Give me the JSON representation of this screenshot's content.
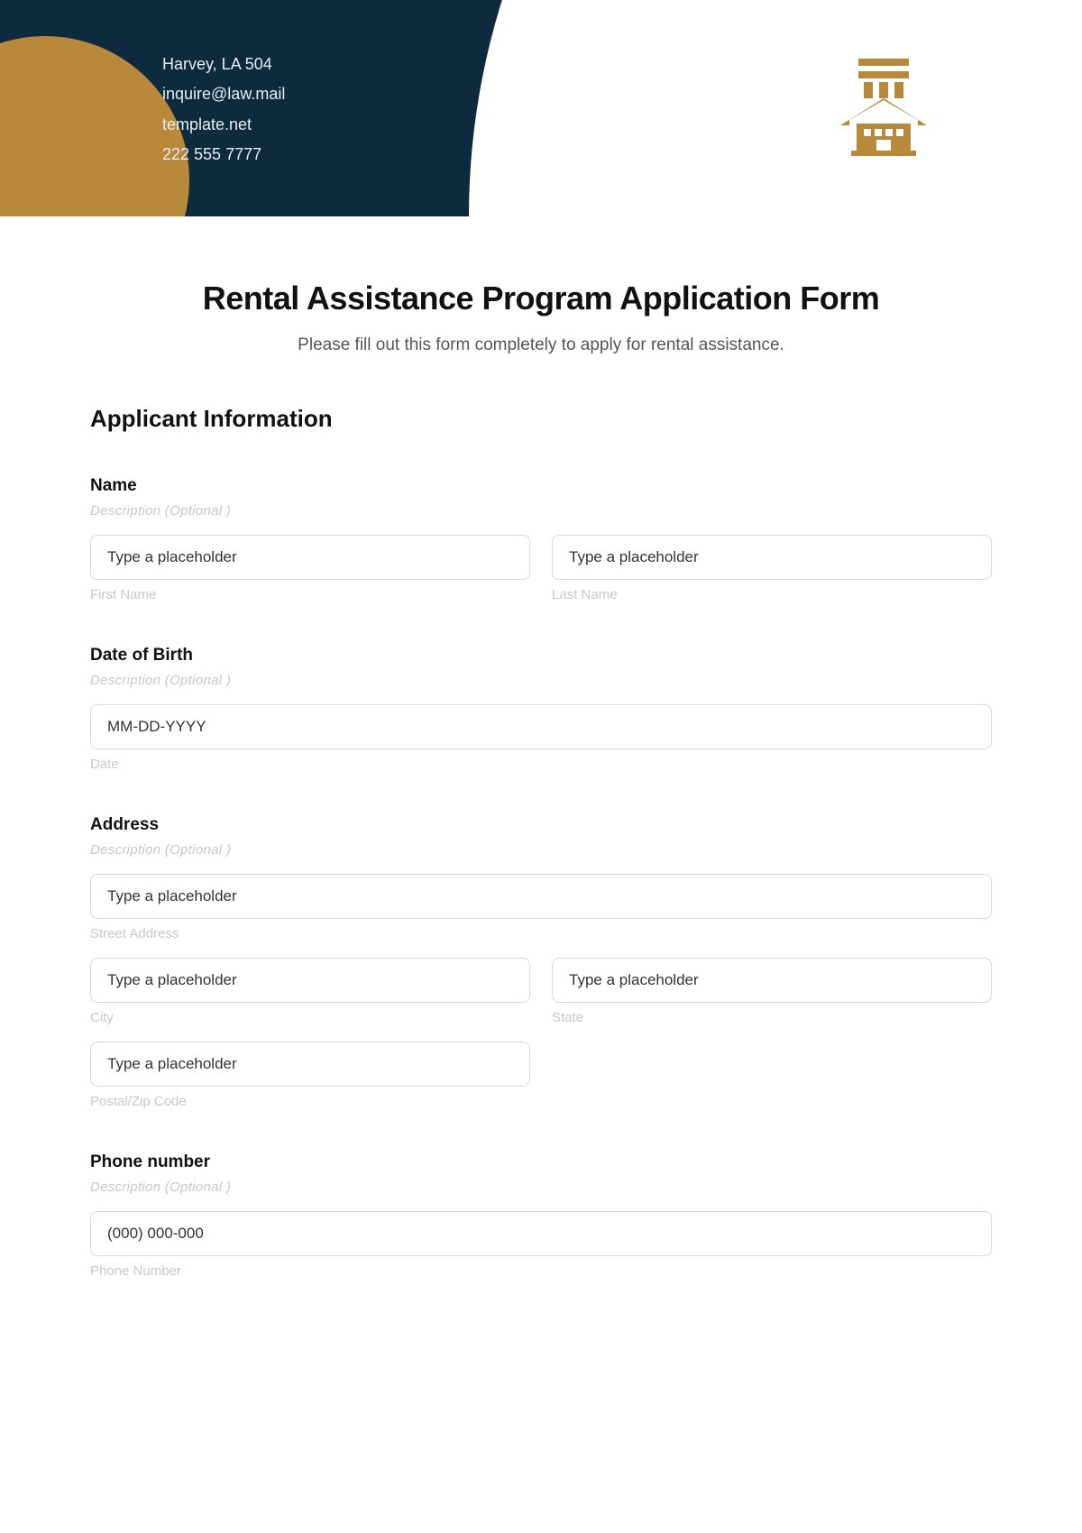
{
  "header": {
    "contact": {
      "address": "Harvey, LA 504",
      "email": "inquire@law.mail",
      "website": "template.net",
      "phone": "222 555 7777"
    }
  },
  "form": {
    "title": "Rental Assistance Program Application Form",
    "subtitle": "Please fill out this form completely to apply for rental assistance.",
    "section_heading": "Applicant Information",
    "desc_optional": "Description (Optional )",
    "placeholder_generic": "Type a placeholder",
    "name": {
      "label": "Name",
      "first_sub": "First Name",
      "last_sub": "Last Name"
    },
    "dob": {
      "label": "Date of Birth",
      "placeholder": "MM-DD-YYYY",
      "sub": "Date"
    },
    "address": {
      "label": "Address",
      "street_sub": "Street Address",
      "city_sub": "City",
      "state_sub": "State",
      "postal_sub": "Postal/Zip Code"
    },
    "phone": {
      "label": "Phone number",
      "placeholder": "(000) 000-000",
      "sub": "Phone Number"
    }
  }
}
